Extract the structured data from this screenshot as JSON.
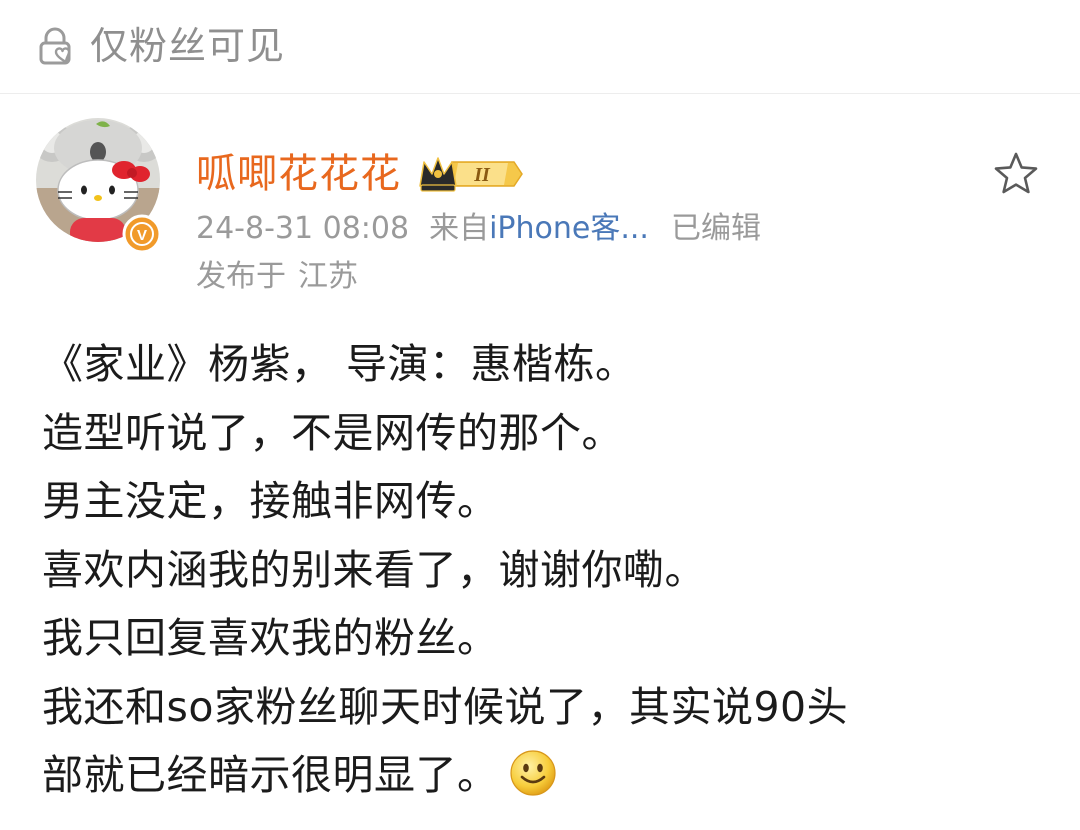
{
  "visibility": {
    "icon": "lock-heart-icon",
    "label": "仅粉丝可见"
  },
  "post": {
    "author": {
      "name": "呱唧花花花",
      "avatar": "avatar-hello-kitty",
      "verified_badge": "V",
      "level_badge": "II"
    },
    "meta": {
      "time": "24-8-31 08:08",
      "from_prefix": "来自",
      "client": "iPhone客...",
      "edited": "已编辑"
    },
    "location": {
      "prefix": "发布于",
      "value": "江苏"
    },
    "favorite_icon": "star-outline-icon",
    "body_lines": [
      "《家业》杨紫， 导演：惠楷栋。",
      "造型听说了，不是网传的那个。",
      "男主没定，接触非网传。",
      "喜欢内涵我的别来看了，谢谢你嘞。",
      "我只回复喜欢我的粉丝。",
      "我还和so家粉丝聊天时候说了，其实说90头",
      "部就已经暗示很明显了。"
    ],
    "trailing_emoji": "smile-emoji"
  },
  "colors": {
    "username": "#e8681e",
    "meta_gray": "#9a9a9a",
    "client_link": "#4a78b8",
    "verified_orange": "#f19a2a"
  }
}
